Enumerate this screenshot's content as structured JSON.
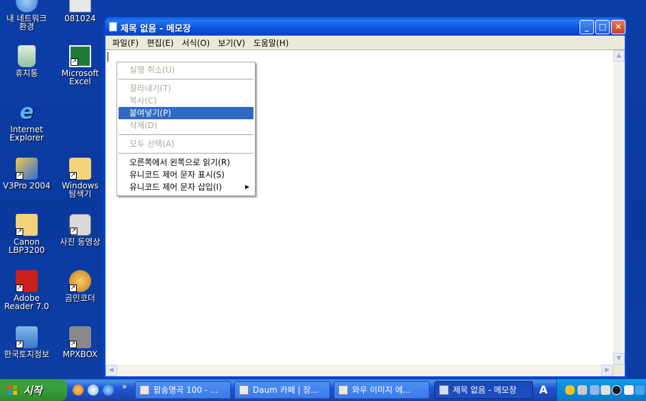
{
  "desktop": {
    "icons": [
      {
        "label": "내 네트워크\n환경"
      },
      {
        "label": "081024"
      },
      {
        "label": "휴지통"
      },
      {
        "label": "Microsoft\nExcel"
      },
      {
        "label": "Internet\nExplorer"
      },
      {
        "label": "V3Pro 2004"
      },
      {
        "label": "Windows\n탐색기"
      },
      {
        "label": "Canon\nLBP3200"
      },
      {
        "label": "사진 동영상"
      },
      {
        "label": "Adobe\nReader 7.0"
      },
      {
        "label": "곰인코더"
      },
      {
        "label": "한국토지정보"
      },
      {
        "label": "MPXBOX"
      }
    ]
  },
  "window": {
    "title": "제목 없음 - 메모장",
    "menu": [
      "파일(F)",
      "편집(E)",
      "서식(O)",
      "보기(V)",
      "도움말(H)"
    ],
    "buttons": {
      "minimize": "_",
      "maximize": "□",
      "close": "✕"
    }
  },
  "context_menu": {
    "undo": "실행 취소(U)",
    "cut": "잘라내기(T)",
    "copy": "복사(C)",
    "paste": "붙여넣기(P)",
    "delete": "삭제(D)",
    "select_all": "모두 선택(A)",
    "rtl": "오른쪽에서 왼쪽으로 읽기(R)",
    "show_unicode": "유니코드 제어 문자 표시(S)",
    "insert_unicode": "유니코드 제어 문자 삽입(I)",
    "submenu_arrow": "▶"
  },
  "taskbar": {
    "start_label": "시작",
    "quicklaunch_more": "»",
    "tasks": [
      {
        "label": "팝송명곡 100 - ..."
      },
      {
        "label": "Daum 카페 | 장..."
      },
      {
        "label": "와우 이미지 에..."
      },
      {
        "label": "제목 없음 - 메모장"
      }
    ],
    "ime": "A"
  }
}
